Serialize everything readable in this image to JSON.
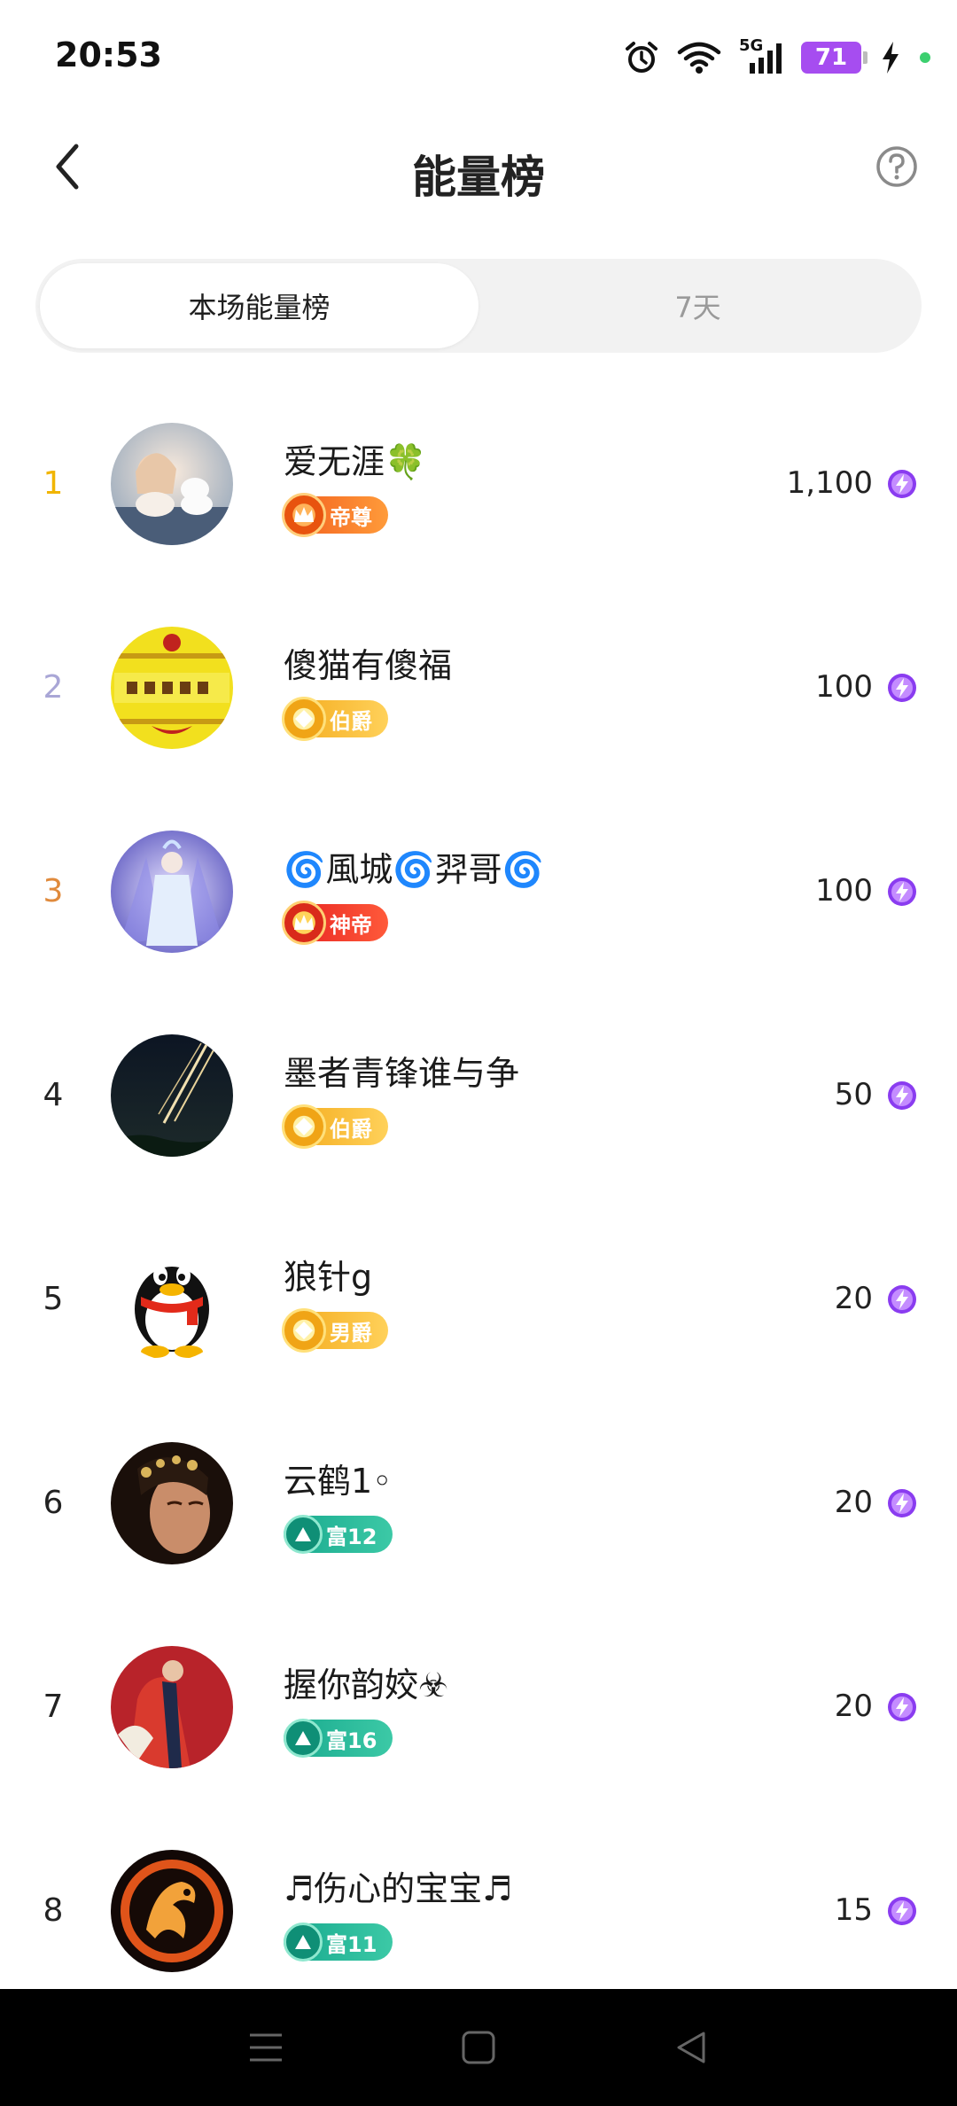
{
  "status_bar": {
    "time": "20:53",
    "signal_label": "5G",
    "battery_percent": "71",
    "icons": [
      "alarm-icon",
      "wifi-icon",
      "signal-icon",
      "battery-icon",
      "charging-icon"
    ]
  },
  "header": {
    "title": "能量榜",
    "back_icon": "chevron-left-icon",
    "help_icon": "question-circle-icon"
  },
  "tabs": [
    {
      "label": "本场能量榜",
      "active": true
    },
    {
      "label": "7天",
      "active": false
    }
  ],
  "ranking": [
    {
      "rank": "1",
      "name": "爱无涯🍀",
      "badge": "帝尊",
      "badge_type": "emperor",
      "score": "1,100"
    },
    {
      "rank": "2",
      "name": "傻猫有傻福",
      "badge": "伯爵",
      "badge_type": "gold-b",
      "score": "100"
    },
    {
      "rank": "3",
      "name": "🌀風城🌀羿哥🌀",
      "badge": "神帝",
      "badge_type": "god",
      "score": "100"
    },
    {
      "rank": "4",
      "name": "墨者青锋谁与争",
      "badge": "伯爵",
      "badge_type": "gold-b",
      "score": "50"
    },
    {
      "rank": "5",
      "name": "狼针g",
      "badge": "男爵",
      "badge_type": "gold-b",
      "score": "20"
    },
    {
      "rank": "6",
      "name": "云鹤1◦",
      "badge": "富12",
      "badge_type": "rich",
      "score": "20"
    },
    {
      "rank": "7",
      "name": "握你韵姣☣",
      "badge": "富16",
      "badge_type": "rich",
      "score": "20"
    },
    {
      "rank": "8",
      "name": "♬伤心的宝宝♬",
      "badge": "富11",
      "badge_type": "rich",
      "score": "15"
    }
  ],
  "colors": {
    "rank1": "#f1b500",
    "rank2": "#a9a6d6",
    "rank3": "#e08a3c",
    "energy": "#8a3cf0"
  },
  "system_nav": {
    "icons": [
      "menu-icon",
      "home-icon",
      "back-icon"
    ]
  }
}
